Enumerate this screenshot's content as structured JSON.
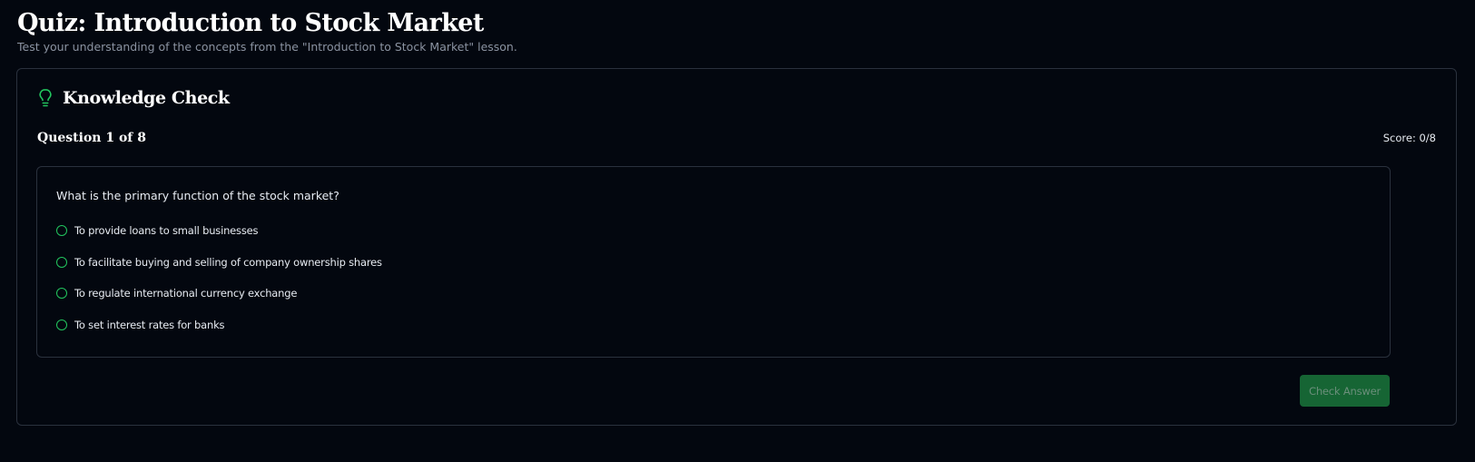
{
  "page": {
    "title": "Quiz: Introduction to Stock Market",
    "subtitle": "Test your understanding of the concepts from the \"Introduction to Stock Market\" lesson."
  },
  "card": {
    "title": "Knowledge Check",
    "icon": "lightbulb-icon",
    "question_count": "Question 1 of 8",
    "score": "Score: 0/8",
    "question": {
      "text": "What is the primary function of the stock market?",
      "options": [
        "To provide loans to small businesses",
        "To facilitate buying and selling of company ownership shares",
        "To regulate international currency exchange",
        "To set interest rates for banks"
      ],
      "selected": null
    },
    "check_button_label": "Check Answer",
    "check_button_enabled": false
  },
  "colors": {
    "background": "#03070f",
    "border": "#2a313d",
    "accent": "#22c55e",
    "button_bg": "#166534",
    "button_text_disabled": "#6b8f7b"
  }
}
